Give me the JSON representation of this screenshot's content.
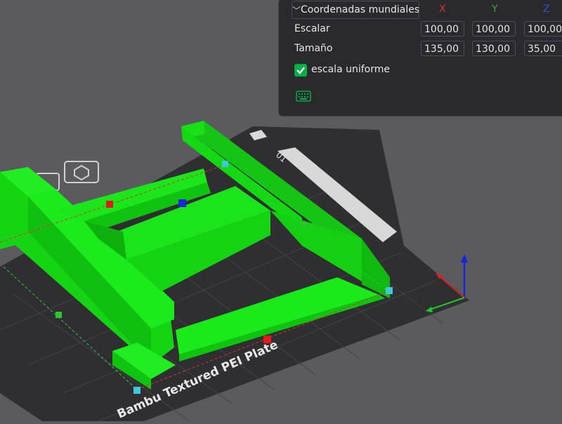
{
  "panel": {
    "coord_dropdown": "Coordenadas mundiales",
    "axes": [
      {
        "label": "X",
        "color": "#d83434"
      },
      {
        "label": "Y",
        "color": "#34b034"
      },
      {
        "label": "Z",
        "color": "#3a4ad8"
      }
    ],
    "rows": [
      {
        "label": "Escalar",
        "values": [
          "100,00",
          "100,00",
          "100,00"
        ]
      },
      {
        "label": "Tamaño",
        "values": [
          "135,00",
          "130,00",
          "35,00"
        ]
      }
    ],
    "uniform_scale": {
      "label": "escala uniforme",
      "checked": true
    }
  },
  "plate": {
    "label": "Bambu Textured PEI Plate",
    "plate_number": "01"
  },
  "colors": {
    "model": "#12e612",
    "plate": "#333336",
    "accent": "#00ae42",
    "background": "#5a5a5f"
  }
}
